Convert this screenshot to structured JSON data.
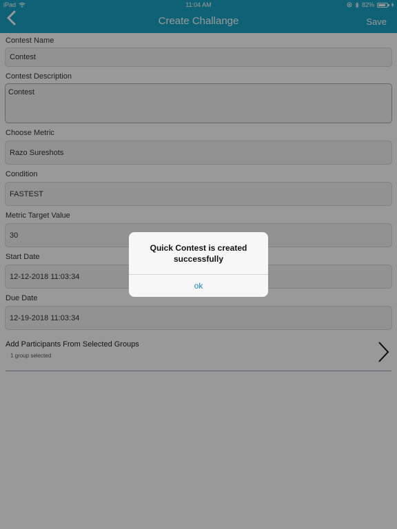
{
  "status": {
    "carrier": "iPad",
    "time": "11:04 AM",
    "battery": "82%",
    "battery_level": 0.82
  },
  "nav": {
    "title": "Create Challange",
    "save_label": "Save"
  },
  "form": {
    "contest_name_label": "Contest Name",
    "contest_name_value": "Contest",
    "description_label": "Contest Description",
    "description_value": "Contest",
    "metric_label": "Choose Metric",
    "metric_value": "Razo Sureshots",
    "condition_label": "Condition",
    "condition_value": "FASTEST",
    "target_label": "Metric Target Value",
    "target_value": "30",
    "start_label": "Start Date",
    "start_value": "12-12-2018 11:03:34",
    "due_label": "Due Date",
    "due_value": "12-19-2018 11:03:34",
    "participants_label": "Add Participants From Selected Groups",
    "participants_sub": "1 group selected"
  },
  "alert": {
    "message": "Quick Contest is  created successfully",
    "ok_label": "ok"
  },
  "colors": {
    "navbar": "#1aa3c4",
    "alert_button": "#1a87c9"
  }
}
